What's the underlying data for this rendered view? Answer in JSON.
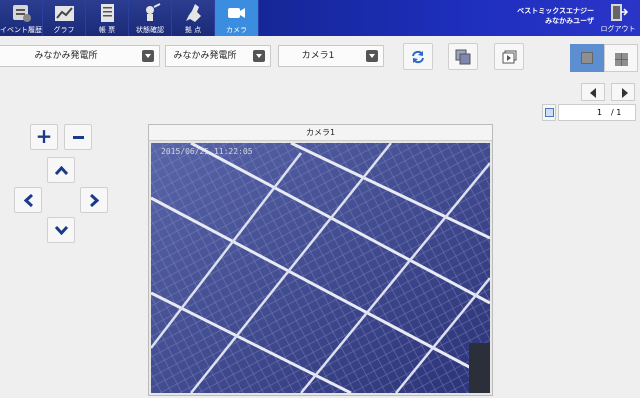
{
  "nav": {
    "items": [
      {
        "label": "イベント履歴",
        "icon": "event-history-icon"
      },
      {
        "label": "グラフ",
        "icon": "graph-icon"
      },
      {
        "label": "帳 票",
        "icon": "report-icon"
      },
      {
        "label": "状態確認",
        "icon": "status-check-icon"
      },
      {
        "label": "拠 点",
        "icon": "site-map-icon"
      },
      {
        "label": "カメラ",
        "icon": "camera-icon"
      }
    ],
    "active": "カメラ",
    "company": "ベストミックスエナジー",
    "user": "みなかみユーザ",
    "logout": "ログアウト"
  },
  "toolbar": {
    "select1": "みなかみ発電所",
    "select2": "みなかみ発電所",
    "select3": "カメラ1"
  },
  "pager": {
    "current": "1",
    "total": "/ 1"
  },
  "camera": {
    "title": "カメラ1",
    "timestamp": "2015/06/25 11:22:05"
  },
  "colors": {
    "nav_bg": "#16289c",
    "nav_active": "#3b8de0",
    "accent": "#1d3a8a",
    "view_active": "#5d8fd0"
  }
}
